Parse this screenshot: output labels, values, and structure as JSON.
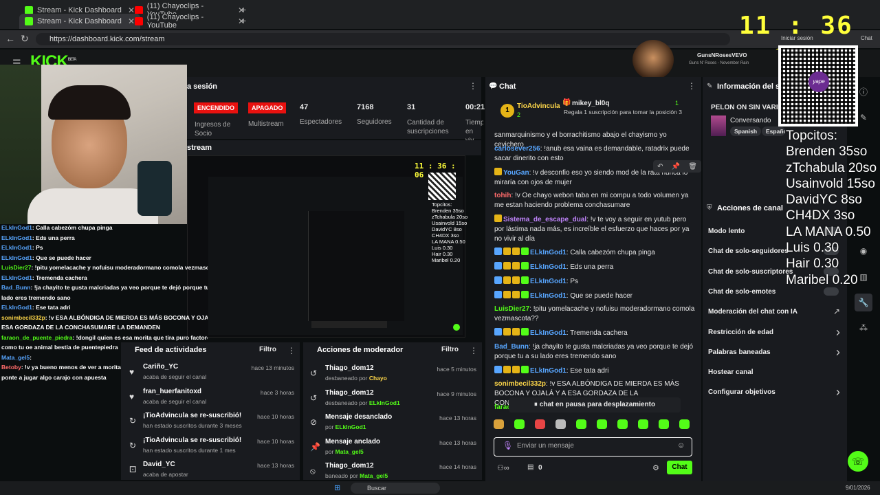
{
  "browser": {
    "tabs": [
      {
        "label": "Stream - Kick Dashboard",
        "active": false
      },
      {
        "label": "(11) Chayoclips - YouTube",
        "active": false
      },
      {
        "label": "Stream - Kick Dashboard",
        "active": true
      },
      {
        "label": "(11) Chayoclips - YouTube",
        "active": false
      }
    ],
    "url": "https://dashboard.kick.com/stream",
    "signin": "Iniciar sesión",
    "chat_btn": "Chat"
  },
  "overlay": {
    "clock": "11 : 36 : 06",
    "music_title": "GunsNRosesVEVO",
    "music_sub": "Guns N' Roses - November Rain",
    "topcitos": [
      "Topcitos:",
      "Brenden 35so",
      "zTchabula 20so",
      "Usainvold 15so",
      "DavidYC 8so",
      "CH4DX 3so",
      "LA MANA 0.50",
      "Luis 0.30",
      "Hair 0.30",
      "Maribel 0.20"
    ],
    "qr_caption": "yape"
  },
  "kick": {
    "logo": "KICK",
    "logo_sup": "BETA"
  },
  "session": {
    "header": "a sesión",
    "status_on": "ENCENDIDO",
    "status_off": "APAGADO",
    "label_ingresos": "Ingresos de Socio",
    "label_multistream": "Multistream",
    "stats": [
      {
        "value": "47",
        "label": "Espectadores"
      },
      {
        "value": "7168",
        "label": "Seguidores"
      },
      {
        "value": "31",
        "label": "Cantidad de suscripciones"
      },
      {
        "value": "00:21",
        "label": "Tiemp en viv"
      }
    ],
    "stream_header": "stream"
  },
  "webcam_chat": [
    {
      "user": "ELkInGod1",
      "text": ": Calla cabezóm chupa pinga",
      "color": "#58a6ff"
    },
    {
      "user": "ELkInGod1",
      "text": ": Eds una perra",
      "color": "#58a6ff"
    },
    {
      "user": "ELkInGod1",
      "text": ": Ps",
      "color": "#58a6ff"
    },
    {
      "user": "ELkInGod1",
      "text": ": Que se puede hacer",
      "color": "#58a6ff"
    },
    {
      "user": "LuisDier27",
      "text": ": !pitu yomelacache y nofuisu moderadormano comola vezmascota??",
      "color": "#53fc18"
    },
    {
      "user": "ELkInGod1",
      "text": ": Tremenda cachera",
      "color": "#58a6ff"
    },
    {
      "user": "Bad_Bunn",
      "text": ": !ja chayito te gusta malcriadas ya veo porque te dejó porque tu a su",
      "color": "#58a6ff"
    },
    {
      "user": "",
      "text": "lado eres tremendo sano",
      "color": "#ffffff"
    },
    {
      "user": "ELkInGod1",
      "text": ": Ese tata adri",
      "color": "#58a6ff"
    },
    {
      "user": "sonimbecil332p",
      "text": ": !v ESA ALBÓNDIGA DE MIERDA ES MÁS BOCONA Y OJALÁ Y A",
      "color": "#ffd84a"
    },
    {
      "user": "",
      "text": "ESA GORDAZA DE LA CONCHASUMARE LA DEMANDEN",
      "color": "#ffffff"
    },
    {
      "user": "faraon_de_puente_piedra",
      "text": ": !dongil quien es esa morita que tira puro factores no",
      "color": "#53fc18"
    },
    {
      "user": "",
      "text": "como tu oe animal bestia de puentepiedra",
      "color": "#ffffff"
    },
    {
      "user": "Mata_gel5",
      "text": ":",
      "color": "#58a6ff"
    },
    {
      "user": "Betoby",
      "text": ": !v ya bueno menos de ver a morita insultando más a jugar, así que",
      "color": "#ff6b6b"
    },
    {
      "user": "",
      "text": "ponte a jugar algo carajo con apuesta",
      "color": "#ffffff"
    }
  ],
  "activity": {
    "header": "Feed de actividades",
    "filter": "Filtro",
    "items": [
      {
        "title": "Cariño_YC",
        "sub": "acaba de seguir el canal",
        "time": "hace 13 minutos"
      },
      {
        "title": "fran_huerfanitoxd",
        "sub": "acaba de seguir el canal",
        "time": "hace 3 horas"
      },
      {
        "title": "¡TioAdvincula se re-suscribió!",
        "sub": "han estado suscritos durante 3 meses",
        "time": "hace 10 horas"
      },
      {
        "title": "¡TioAdvincula se re-suscribió!",
        "sub": "han estado suscritos durante 1 mes",
        "time": "hace 10 horas"
      },
      {
        "title": "David_YC",
        "sub": "acaba de apostar",
        "time": "hace 13 horas"
      }
    ]
  },
  "modactions": {
    "header": "Acciones de moderador",
    "filter": "Filtro",
    "items": [
      {
        "title": "Thiago_dom12",
        "sub": "desbaneado por",
        "by": "Chayo",
        "time": "hace 5 minutos",
        "icon": "undo-icon"
      },
      {
        "title": "Thiago_dom12",
        "sub": "desbaneado por",
        "by": "ELkInGod1",
        "time": "hace 9 minutos",
        "icon": "undo-icon"
      },
      {
        "title": "Mensaje desanclado",
        "sub": "por",
        "by": "ELkInGod1",
        "time": "hace 13 horas",
        "icon": "unpin-icon"
      },
      {
        "title": "Mensaje anclado",
        "sub": "por",
        "by": "Mata_gel5",
        "time": "hace 13 horas",
        "icon": "pin-icon"
      },
      {
        "title": "Thiago_dom12",
        "sub": "baneado por",
        "by": "Mata_gel5",
        "time": "hace 14 horas",
        "icon": "ban-icon"
      }
    ]
  },
  "chat": {
    "header": "Chat",
    "pinned_user1": "TioAdvincula",
    "pinned_num1": "2",
    "pinned_user2": "mikey_bl0q",
    "pinned_sub2": "Regala 1 suscripción para tomar la posición 3",
    "pinned_num2": "1",
    "rank1": "1",
    "rank2": "3",
    "messages": [
      {
        "user": "",
        "text": "sanmarquinismo y el borrachitismo abajo el chayismo yo cevichero",
        "color": "#ffffff"
      },
      {
        "user": "carlosever256",
        "text": ": !anub esa vaina es demandable, ratadrix puede sacar dinerito con esto",
        "color": "#58a6ff"
      },
      {
        "user": "YouGan",
        "text": ": !v desconfio eso yo siendo mod de la rata nunca lo miraría con ojos de mujer",
        "color": "#58a6ff"
      },
      {
        "user": "tohih",
        "text": ": !v Oe chayo webon taba en mi compu a todo volumen ya me estan haciendo problema conchasumare",
        "color": "#ff6b6b"
      },
      {
        "user": "Sistema_de_escape_dual",
        "text": ": !v te voy a seguir en yutub pero por lástima nada más, es increíble el esfuerzo que haces por ya no vivir al día",
        "color": "#c084fc"
      },
      {
        "user": "ELkInGod1",
        "text": ": Calla cabezóm chupa pinga",
        "color": "#58a6ff"
      },
      {
        "user": "ELkInGod1",
        "text": ": Eds una perra",
        "color": "#58a6ff"
      },
      {
        "user": "ELkInGod1",
        "text": ": Ps",
        "color": "#58a6ff"
      },
      {
        "user": "ELkInGod1",
        "text": ": Que se puede hacer",
        "color": "#58a6ff"
      },
      {
        "user": "LuisDier27",
        "text": ": !pitu yomelacache y nofuisu moderadormano comola vezmascota??",
        "color": "#53fc18"
      },
      {
        "user": "ELkInGod1",
        "text": ": Tremenda cachera",
        "color": "#58a6ff"
      },
      {
        "user": "Bad_Bunn",
        "text": ": !ja chayito te gusta malcriadas ya veo porque te dejó porque tu a su lado eres tremendo sano",
        "color": "#58a6ff"
      },
      {
        "user": "ELkInGod1",
        "text": ": Ese tata adri",
        "color": "#58a6ff"
      },
      {
        "user": "sonimbecil332p",
        "text": ": !v ESA ALBÓNDIGA DE MIERDA ES MÁS BOCONA Y OJALÁ Y A ESA GORDAZA DE LA CONCHASUMARE LA DEMANDEN",
        "color": "#ffd84a"
      },
      {
        "user": "faraon_de_p",
        "text": "",
        "color": "#53fc18"
      }
    ],
    "paused": "chat en pausa para desplazamiento",
    "input_placeholder": "Enviar un mensaje",
    "count": "0",
    "send": "Chat"
  },
  "info": {
    "header": "Información del stream",
    "title": "PELON ON SIN VARIEDADES",
    "category": "Conversando",
    "tags": [
      "Spanish",
      "Español"
    ]
  },
  "channel": {
    "header": "Acciones de canal",
    "items": [
      {
        "label": "Modo lento",
        "chevron": false
      },
      {
        "label": "Chat de solo-seguidores",
        "chevron": false
      },
      {
        "label": "Chat de solo-suscriptores",
        "chevron": false
      },
      {
        "label": "Chat de solo-emotes",
        "chevron": false
      },
      {
        "label": "Moderación del chat con IA",
        "chevron": false
      },
      {
        "label": "Restricción de edad",
        "chevron": true
      },
      {
        "label": "Palabras baneadas",
        "chevron": true
      },
      {
        "label": "Hostear canal",
        "chevron": false
      },
      {
        "label": "Configurar objetivos",
        "chevron": true
      }
    ]
  },
  "taskbar": {
    "search": "Buscar",
    "date": "9/01/2026"
  },
  "colors": {
    "kick_green": "#53fc18",
    "on_red": "#ff2b2b",
    "bg": "#0b0e0f",
    "panel": "#191b1f"
  }
}
